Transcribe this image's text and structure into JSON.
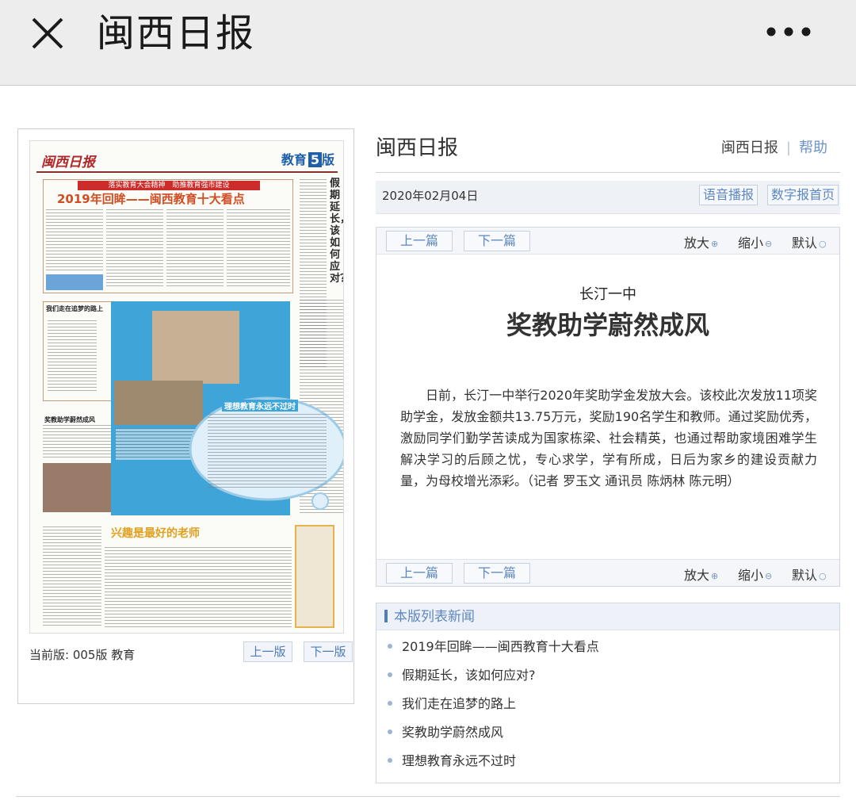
{
  "appbar": {
    "title": "闽西日报",
    "close_icon": "close-icon",
    "more_icon": "more-dots-icon"
  },
  "paper": {
    "logo": "闽西日报",
    "section": "教育",
    "section_no": "5",
    "section_suffix": "版",
    "banner": "落实教育大会精神　助推教育强市建设",
    "main_head": "2019年回眸——闽西教育十大看点",
    "vertical_head": "假期延长，该如何应对？",
    "side_head_1": "我们走在追梦的路上",
    "side_head_2": "奖教助学蔚然成风",
    "bubble_head": "理想教育永远不过时",
    "bottom_head": "兴趣是最好的老师",
    "current_edition": "当前版: 005版 教育",
    "prev_edition": "上一版",
    "next_edition": "下一版"
  },
  "right": {
    "title": "闽西日报",
    "link_home": "闽西日报",
    "link_help": "帮助",
    "date": "2020年02月04日",
    "btn_voice": "语音播报",
    "btn_home": "数字报首页"
  },
  "article": {
    "prev": "上一篇",
    "next": "下一篇",
    "zoom_in": "放大",
    "zoom_out": "缩小",
    "default": "默认",
    "subhead": "长汀一中",
    "headline": "奖教助学蔚然成风",
    "body": "日前，长汀一中举行2020年奖助学金发放大会。该校此次发放11项奖助学金，发放金额共13.75万元，奖励190名学生和教师。通过奖励优秀，激励同学们勤学苦读成为国家栋梁、社会精英，也通过帮助家境困难学生解决学习的后顾之忧，专心求学，学有所成，日后为家乡的建设贡献力量，为母校增光添彩。（记者 罗玉文 通讯员 陈炳林 陈元明）"
  },
  "list": {
    "header": "本版列表新闻",
    "items": [
      "2019年回眸——闽西教育十大看点",
      "假期延长，该如何应对?",
      "我们走在追梦的路上",
      "奖教助学蔚然成风",
      "理想教育永远不过时"
    ]
  }
}
